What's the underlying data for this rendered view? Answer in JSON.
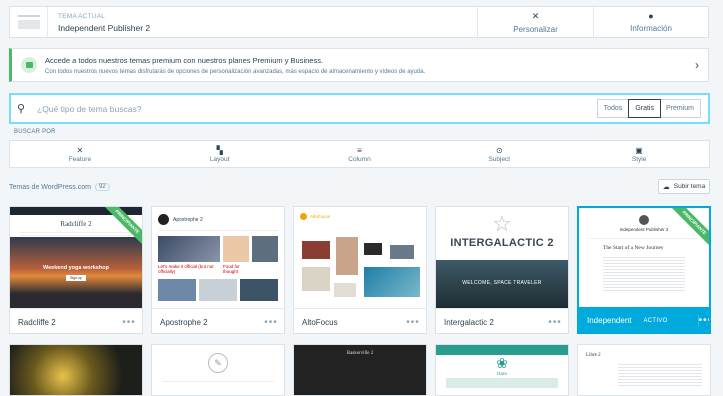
{
  "current_theme": {
    "label": "TEMA ACTUAL",
    "name": "Independent Publisher 2"
  },
  "actions": {
    "customize": "Personalizar",
    "info": "Información"
  },
  "promo": {
    "title": "Accede a todos nuestros temas premium con nuestros planes Premium y Business.",
    "subtitle": "Con todos nuestros nuevos temas disfrutarás de opciones de personalización avanzadas, más espacio de almacenamiento y vídeos de ayuda."
  },
  "search": {
    "placeholder": "¿Qué tipo de tema buscas?",
    "tiers": [
      "Todos",
      "Gratis",
      "Premium"
    ],
    "selected_tier": "Gratis"
  },
  "filter_label": "BUSCAR POR",
  "filters": [
    "Feature",
    "Layout",
    "Column",
    "Subject",
    "Style"
  ],
  "section": {
    "title": "Temas de WordPress.com",
    "count": "92",
    "upload": "Subir tema"
  },
  "themes": [
    {
      "name": "Radcliffe 2",
      "badge": "PRINCIPIANTE"
    },
    {
      "name": "Apostrophe 2"
    },
    {
      "name": "AltoFocus"
    },
    {
      "name": "Intergalactic 2"
    },
    {
      "name": "Independent",
      "status": "ACTIVO",
      "badge": "PRINCIPIANTE"
    }
  ],
  "previews": {
    "radcliffe": {
      "title": "Radcliffe 2",
      "hero": "Weekend yoga workshop",
      "cta": "Sign up"
    },
    "apostrophe": {
      "title": "Apostrophe 2",
      "post1": "Let's make it official (but not officially)",
      "post2": "Food for thought"
    },
    "altofocus": {
      "title": "AltoFocus"
    },
    "intergalactic": {
      "title": "INTERGALACTIC 2",
      "tagline": "WELCOME, SPACE TRAVELER"
    },
    "independent": {
      "title": "Independent Publisher 2",
      "post": "The Start of a New Journey"
    },
    "row2": [
      "Baskerville 2",
      "Dara",
      "Libre 2"
    ]
  },
  "colors": {
    "accent": "#00aadc",
    "search_border": "#78dcfa",
    "promo_green": "#4ab866"
  },
  "icons": {
    "customize": "tools-icon",
    "info": "info-icon",
    "promo": "gift-icon",
    "search": "search-icon",
    "upload": "cloud-upload-icon",
    "next": "chevron-right-icon"
  }
}
